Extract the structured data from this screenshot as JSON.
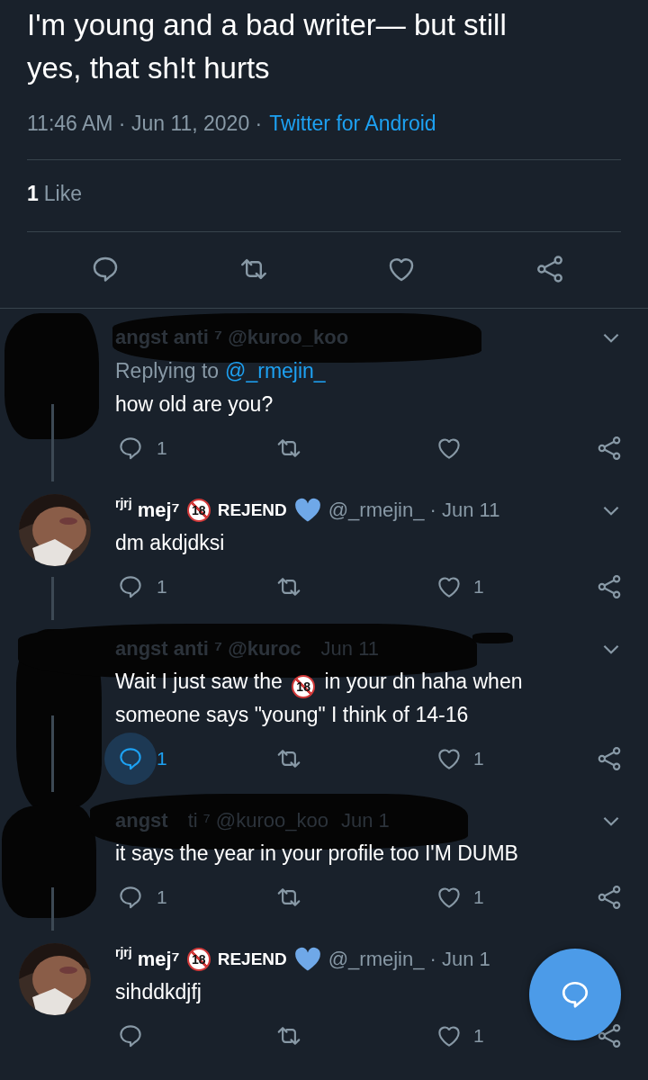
{
  "main_tweet": {
    "text": "I'm young and a bad writer— but still yes, that sh!t hurts",
    "time": "11:46 AM",
    "separator": "·",
    "date": "Jun 11, 2020",
    "source": "Twitter for Android",
    "likes_count": "1",
    "likes_label": "Like"
  },
  "replies": [
    {
      "kind": "redacted",
      "header": [
        "angst anti ⁷ @kuroo_koo"
      ],
      "replying_label": "Replying to",
      "replying_handle": "@_rmejin_",
      "body": "how old are you?",
      "reply_count": "1",
      "reply_highlighted": false
    },
    {
      "kind": "user",
      "name_prefix": "rjrj",
      "name": "mej⁷",
      "badge": "18",
      "tag": "REJEND",
      "handle": "@_rmejin_",
      "separator": "·",
      "date": "Jun 11",
      "body": "dm akdjdksi",
      "reply_count": "1",
      "like_count": "1",
      "reply_highlighted": false
    },
    {
      "kind": "redacted",
      "header": [
        "angst anti ⁷ @kuroc",
        "Jun 11"
      ],
      "body": "Wait I just saw the ",
      "body_emoji": "18",
      "body_after": " in your dn haha when someone says \"young\" I think of 14-16",
      "reply_count": "1",
      "like_count": "1",
      "reply_highlighted": true
    },
    {
      "kind": "redacted",
      "header": [
        "angst",
        "ti ⁷ @kuroo_koo",
        "Jun 1"
      ],
      "body": "it says the year in your profile too I'M DUMB",
      "reply_count": "1",
      "like_count": "1",
      "reply_highlighted": false
    },
    {
      "kind": "user",
      "name_prefix": "rjrj",
      "name": "mej⁷",
      "badge": "18",
      "tag": "REJEND",
      "handle": "@_rmejin_",
      "separator": "·",
      "date": "Jun 1",
      "body": "sihddkdjfj",
      "like_count": "1",
      "reply_highlighted": false
    }
  ]
}
